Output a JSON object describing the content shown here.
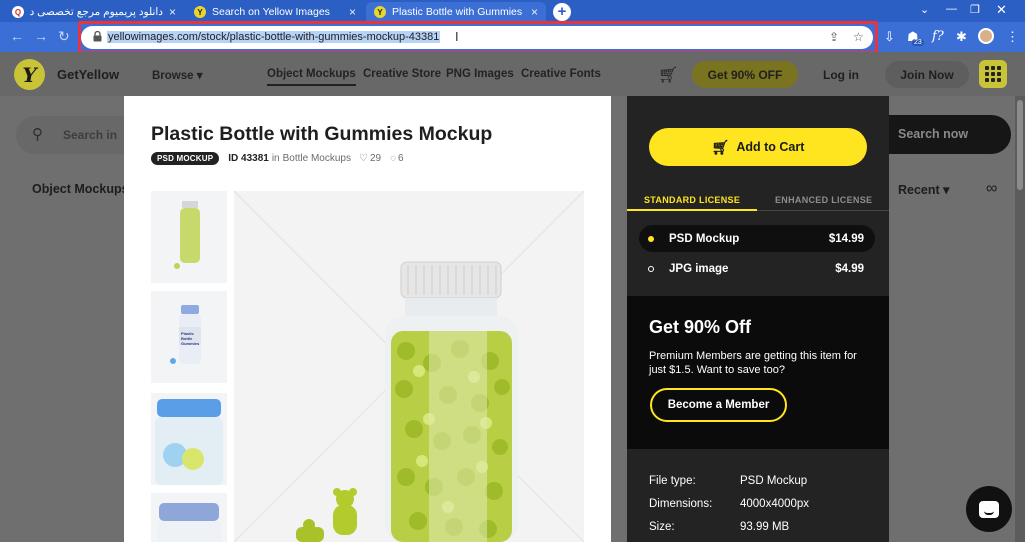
{
  "browser": {
    "tabs": [
      {
        "title": "دانلود پریمیوم مرجع تخصصی دانلود",
        "close": "×"
      },
      {
        "title": "Search on Yellow Images",
        "close": "×"
      },
      {
        "title": "Plastic Bottle with Gummies Moc",
        "close": "×"
      }
    ],
    "new_tab": "+",
    "url": "yellowimages.com/stock/plastic-bottle-with-gummies-mockup-43381",
    "extension_badge": "23",
    "accent": "#3c6fd6"
  },
  "site": {
    "brand_initial": "Y",
    "brand": "GetYellow",
    "nav": {
      "browse": "Browse ▾",
      "object_mockups": "Object Mockups",
      "creative_store": "Creative Store",
      "png_images": "PNG Images",
      "creative_fonts": "Creative Fonts"
    },
    "cta": "Get 90% OFF",
    "login": "Log in",
    "join": "Join Now",
    "search_placeholder": "Search in",
    "search_button": "Search now",
    "filter_label": "Object Mockups",
    "sort_label": "Recent ▾",
    "accent": "#ffe51f"
  },
  "product": {
    "title": "Plastic Bottle with Gummies Mockup",
    "badge": "PSD MOCKUP",
    "id_label": "ID 43381",
    "in_label": "in",
    "category": "Bottle Mockups",
    "likes": "29",
    "comments": "6",
    "thumb_bottle_label": "Plastic Bottle Gummies"
  },
  "panel": {
    "add_to_cart": "Add to Cart",
    "license_standard": "STANDARD LICENSE",
    "license_enhanced": "ENHANCED LICENSE",
    "options": [
      {
        "name": "PSD Mockup",
        "price": "$14.99",
        "selected": true
      },
      {
        "name": "JPG image",
        "price": "$4.99",
        "selected": false
      }
    ],
    "promo_title": "Get 90% Off",
    "promo_text": "Premium Members are getting this item for just $1.5. Want to save too?",
    "member_button": "Become a Member",
    "specs": [
      {
        "key": "File type:",
        "value": "PSD Mockup"
      },
      {
        "key": "Dimensions:",
        "value": "4000x4000px"
      },
      {
        "key": "Size:",
        "value": "93.99 MB"
      }
    ]
  }
}
